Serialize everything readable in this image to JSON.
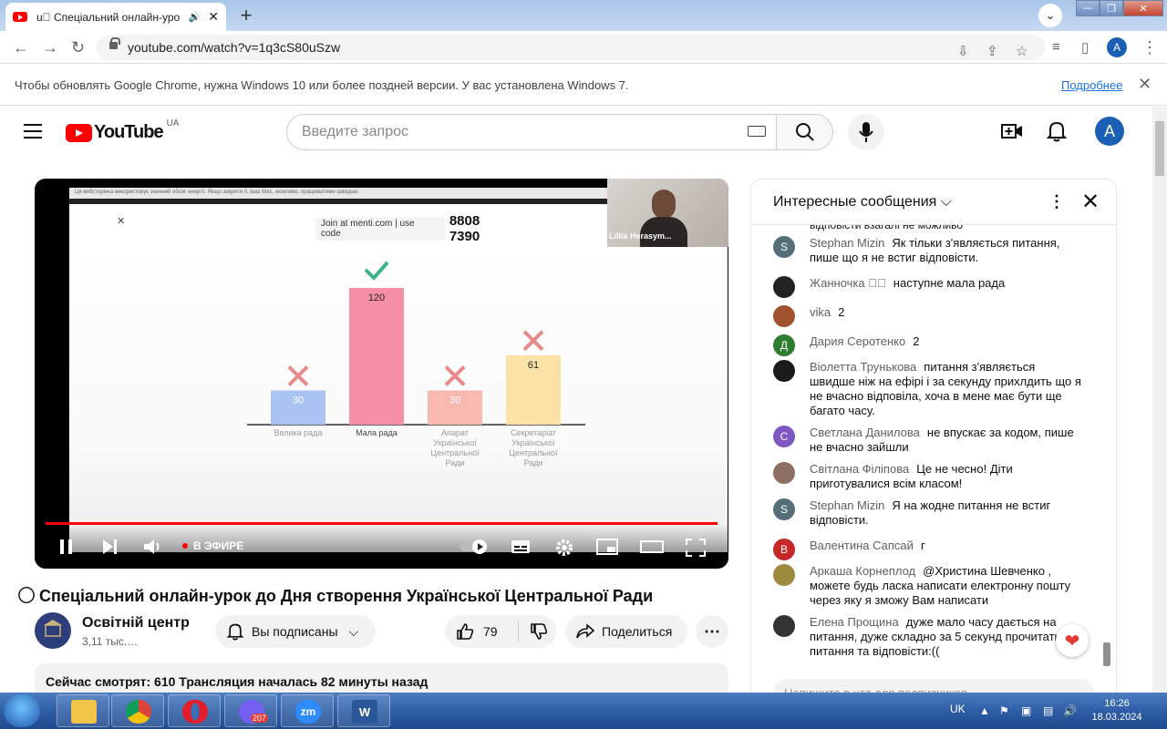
{
  "browser": {
    "tab_title": "u⃝ Спеціальний онлайн-уро",
    "url": "youtube.com/watch?v=1q3cS80uSzw",
    "profile_initial": "A",
    "infobar_message": "Чтобы обновлять Google Chrome, нужна Windows 10 или более поздней версии. У вас установлена Windows 7.",
    "infobar_link": "Подробнее"
  },
  "youtube": {
    "logo_text": "YouTube",
    "country_code": "UA",
    "search_placeholder": "Введите запрос",
    "avatar_initial": "A"
  },
  "video": {
    "slide_notice": "Ця вебсторінка використовує значний обсяг енергії. Якщо закрити її, ваш Mac, можливо, працюватиме швидше.",
    "join_text": "Join at menti.com | use code",
    "join_code": "8808 7390",
    "presenter_name": "Liliia Herasym...",
    "live_label": "В ЭФИРЕ",
    "title": "⃝⃝ Спеціальний онлайн-урок до Дня створення Української Центральної Ради",
    "channel_name": "Освітній центр В",
    "subscribers": "3,11 тыс.…",
    "subscribe_label": "Вы подписаны",
    "likes": "79",
    "share_label": "Поделиться",
    "description_stats": "Сейчас смотрят: 610  Трансляция началась 82 минуты назад"
  },
  "chart_data": {
    "type": "bar",
    "categories": [
      "Велика рада",
      "Мала рада",
      "Апарат Української Центральної Ради",
      "Секретаріат Української Центральної Ради"
    ],
    "values": [
      30,
      120,
      30,
      61
    ],
    "correct": [
      false,
      true,
      false,
      false
    ],
    "colors": [
      "#a9c4f0",
      "#f48fa5",
      "#f8b9b2",
      "#fbe2a6"
    ],
    "ylim": [
      0,
      120
    ]
  },
  "chat": {
    "header_title": "Интересные сообщения",
    "partial_top": "відповісти взагалі не можливо",
    "messages": [
      {
        "author": "Stephan Mizin",
        "text": "Як тільки з'являється питання, пише що я не встиг відповісти.",
        "avatar_letter": "S",
        "avatar_color": "#546e7a"
      },
      {
        "author": "Жанночка ⃝⃝",
        "text": "наступне мала рада",
        "avatar_letter": "",
        "avatar_color": "#222222"
      },
      {
        "author": "vika",
        "text": "2",
        "avatar_letter": "",
        "avatar_color": "#a0522d"
      },
      {
        "author": "Дария Серотенко",
        "text": "2",
        "avatar_letter": "Д",
        "avatar_color": "#2e7d32"
      },
      {
        "author": "Віолетта Трунькова",
        "text": "питання з'являється швидше ніж на ефірі і за секунду прихлдить що я не вчасно відповіла, хоча в мене має бути ще багато часу.",
        "avatar_letter": "",
        "avatar_color": "#1b1b1b"
      },
      {
        "author": "Светлана Данилова",
        "text": "не впускає за кодом, пише не вчасно зайшли",
        "avatar_letter": "С",
        "avatar_color": "#7e57c2"
      },
      {
        "author": "Світлана Філіпова",
        "text": "Це не чесно! Діти приготувалися всім класом!",
        "avatar_letter": "",
        "avatar_color": "#8d6e63"
      },
      {
        "author": "Stephan Mizin",
        "text": "Я на жодне питання не встиг відповісти.",
        "avatar_letter": "S",
        "avatar_color": "#546e7a"
      },
      {
        "author": "Валентина Сапсай",
        "text": "г",
        "avatar_letter": "В",
        "avatar_color": "#c62828"
      },
      {
        "author": "Аркаша Корнеплод",
        "text": "@Христина Шевченко , можете будь ласка написати електронну пошту через яку я зможу Вам написати",
        "avatar_letter": "",
        "avatar_color": "#9e8a3e"
      },
      {
        "author": "Елена Прощина",
        "text": "дуже мало часу дається на питання, дуже складно за 5 секунд прочитати питання та відповісти:((",
        "avatar_letter": "",
        "avatar_color": "#333333"
      }
    ],
    "input_placeholder": "Напишите в чат для подписчиков…"
  },
  "taskbar": {
    "language": "UK",
    "time": "16:26",
    "date": "18.03.2024",
    "viber_badge": "207",
    "zoom_label": "zm"
  }
}
